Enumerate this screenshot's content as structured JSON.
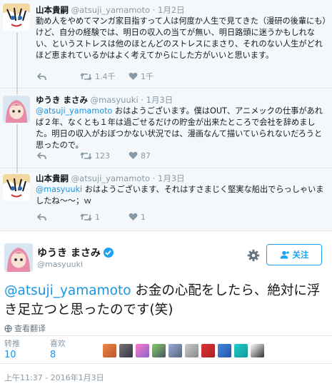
{
  "tweets": [
    {
      "name": "山本貴嗣",
      "handle": "@atsuji_yamamoto",
      "time": "1月2日",
      "text": "勤め人をやめてマンガ家目指すって人は何度か人生で見てきた（漫研の後輩にも）けど、自分の経験では、明日の収入の当てが無い、明日路頭に迷うかもしれない、というストレスは他のほとんどのストレスにまさり、それのない人生がどれほど恵まれているかはよく考えてからにした方がいいと思います。",
      "retweets": "1.4千",
      "likes": "1千"
    },
    {
      "name": "ゆうき まさみ",
      "handle": "@masyuuki",
      "time": "1月3日",
      "mention": "@atsuji_yamamoto",
      "text": " おはようございます。僕はOUT、アニメックの仕事があれば２年、なくとも１年は過ごせるだけの貯金が出来たところで会社を辞めました。明日の収入がおぼつかない状況では、漫画なんて描いていられないだろうと思ったので。",
      "retweets": "123",
      "likes": "87"
    },
    {
      "name": "山本貴嗣",
      "handle": "@atsuji_yamamoto",
      "time": "1月3日",
      "mention": "@masyuuki",
      "text": " おはようございます、それはすさまじく堅実な船出でらっしゃいましたね～～；ｗ",
      "retweets": "1",
      "likes": "1"
    }
  ],
  "main": {
    "name": "ゆうき まさみ",
    "handle": "@masyuuki",
    "follow_label": "关注",
    "mention": "@atsuji_yamamoto",
    "text": " お金の心配をしたら、絶対に浮き足立つと思ったのです(笑)",
    "translate_label": "查看翻译",
    "retweets_label": "转推",
    "retweets": "10",
    "likes_label": "喜欢",
    "likes": "8",
    "timestamp": "上午11:37 - 2016年1月3日"
  },
  "separator": " · ",
  "colors": {
    "accent": "#1da1f2",
    "link": "#1b95e0",
    "muted": "#8899a6"
  }
}
